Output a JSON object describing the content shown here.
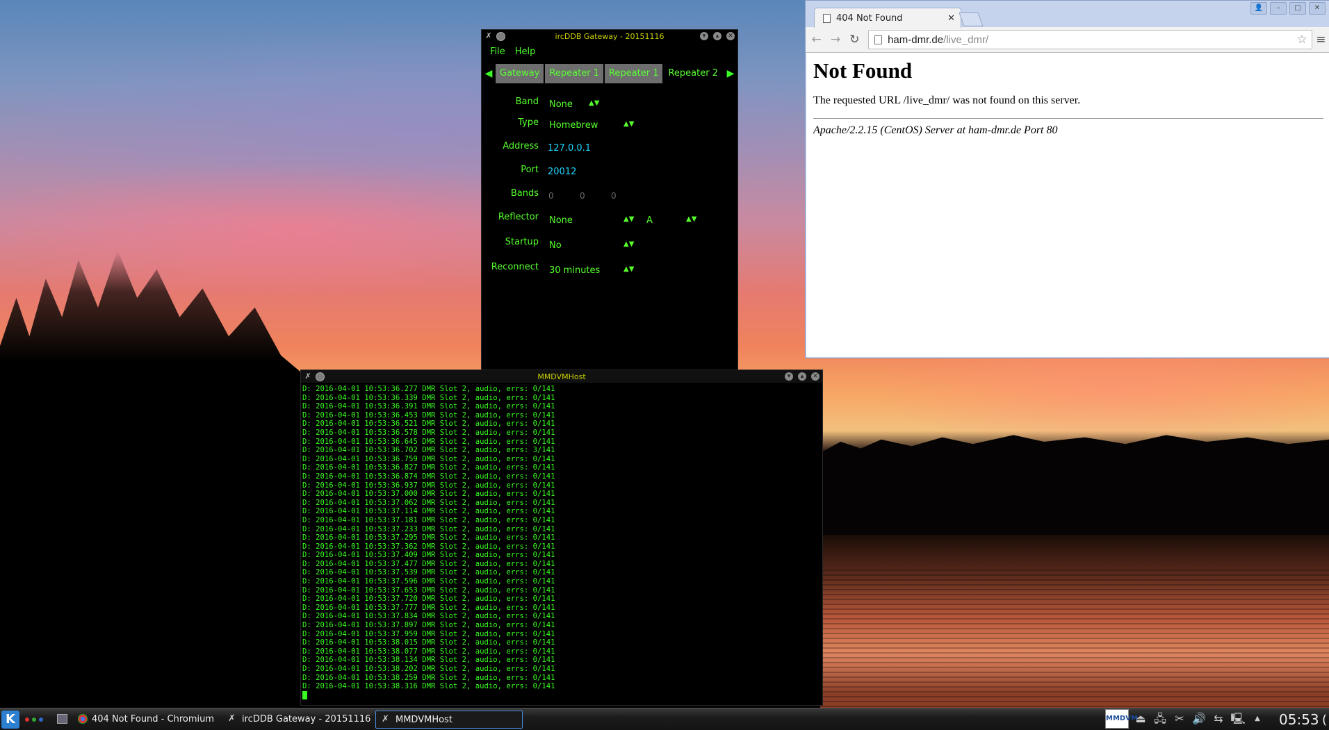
{
  "ircddb": {
    "title": "ircDDB Gateway - 20151116",
    "menu": [
      "File",
      "Help"
    ],
    "tabs": [
      "Gateway",
      "Repeater 1",
      "Repeater 1",
      "Repeater 2"
    ],
    "fields": {
      "band_label": "Band",
      "band_value": "None",
      "type_label": "Type",
      "type_value": "Homebrew",
      "address_label": "Address",
      "address_value": "127.0.0.1",
      "port_label": "Port",
      "port_value": "20012",
      "bands_label": "Bands",
      "bands_values": [
        "0",
        "0",
        "0"
      ],
      "reflector_label": "Reflector",
      "reflector_value": "None",
      "reflector_module": "A",
      "startup_label": "Startup",
      "startup_value": "No",
      "reconnect_label": "Reconnect",
      "reconnect_value": "30 minutes"
    }
  },
  "mmdvm": {
    "title": "MMDVMHost",
    "log_lines": [
      "D: 2016-04-01 10:53:36.277 DMR Slot 2, audio, errs: 0/141",
      "D: 2016-04-01 10:53:36.339 DMR Slot 2, audio, errs: 0/141",
      "D: 2016-04-01 10:53:36.391 DMR Slot 2, audio, errs: 0/141",
      "D: 2016-04-01 10:53:36.453 DMR Slot 2, audio, errs: 0/141",
      "D: 2016-04-01 10:53:36.521 DMR Slot 2, audio, errs: 0/141",
      "D: 2016-04-01 10:53:36.578 DMR Slot 2, audio, errs: 0/141",
      "D: 2016-04-01 10:53:36.645 DMR Slot 2, audio, errs: 0/141",
      "D: 2016-04-01 10:53:36.702 DMR Slot 2, audio, errs: 3/141",
      "D: 2016-04-01 10:53:36.759 DMR Slot 2, audio, errs: 0/141",
      "D: 2016-04-01 10:53:36.827 DMR Slot 2, audio, errs: 0/141",
      "D: 2016-04-01 10:53:36.874 DMR Slot 2, audio, errs: 0/141",
      "D: 2016-04-01 10:53:36.937 DMR Slot 2, audio, errs: 0/141",
      "D: 2016-04-01 10:53:37.000 DMR Slot 2, audio, errs: 0/141",
      "D: 2016-04-01 10:53:37.062 DMR Slot 2, audio, errs: 0/141",
      "D: 2016-04-01 10:53:37.114 DMR Slot 2, audio, errs: 0/141",
      "D: 2016-04-01 10:53:37.181 DMR Slot 2, audio, errs: 0/141",
      "D: 2016-04-01 10:53:37.233 DMR Slot 2, audio, errs: 0/141",
      "D: 2016-04-01 10:53:37.295 DMR Slot 2, audio, errs: 0/141",
      "D: 2016-04-01 10:53:37.362 DMR Slot 2, audio, errs: 0/141",
      "D: 2016-04-01 10:53:37.409 DMR Slot 2, audio, errs: 0/141",
      "D: 2016-04-01 10:53:37.477 DMR Slot 2, audio, errs: 0/141",
      "D: 2016-04-01 10:53:37.539 DMR Slot 2, audio, errs: 0/141",
      "D: 2016-04-01 10:53:37.596 DMR Slot 2, audio, errs: 0/141",
      "D: 2016-04-01 10:53:37.653 DMR Slot 2, audio, errs: 0/141",
      "D: 2016-04-01 10:53:37.720 DMR Slot 2, audio, errs: 0/141",
      "D: 2016-04-01 10:53:37.777 DMR Slot 2, audio, errs: 0/141",
      "D: 2016-04-01 10:53:37.834 DMR Slot 2, audio, errs: 0/141",
      "D: 2016-04-01 10:53:37.897 DMR Slot 2, audio, errs: 0/141",
      "D: 2016-04-01 10:53:37.959 DMR Slot 2, audio, errs: 0/141",
      "D: 2016-04-01 10:53:38.015 DMR Slot 2, audio, errs: 0/141",
      "D: 2016-04-01 10:53:38.077 DMR Slot 2, audio, errs: 0/141",
      "D: 2016-04-01 10:53:38.134 DMR Slot 2, audio, errs: 0/141",
      "D: 2016-04-01 10:53:38.202 DMR Slot 2, audio, errs: 0/141",
      "D: 2016-04-01 10:53:38.259 DMR Slot 2, audio, errs: 0/141",
      "D: 2016-04-01 10:53:38.316 DMR Slot 2, audio, errs: 0/141"
    ]
  },
  "chromium": {
    "tab_title": "404 Not Found",
    "url_host": "ham-dmr.de",
    "url_path": "/live_dmr/",
    "page": {
      "heading": "Not Found",
      "message": "The requested URL /live_dmr/ was not found on this server.",
      "server": "Apache/2.2.15 (CentOS) Server at ham-dmr.de Port 80"
    }
  },
  "taskbar": {
    "tasks": [
      {
        "label": "404 Not Found - Chromium"
      },
      {
        "label": "ircDDB Gateway - 20151116"
      },
      {
        "label": "MMDVMHost"
      }
    ],
    "tray_badge": "MMDVM",
    "clock": "05:53",
    "clock_extra": "("
  },
  "colors": {
    "terminal_green": "#3aff22",
    "value_cyan": "#1fd7ff",
    "title_yellow": "#c8d000"
  }
}
